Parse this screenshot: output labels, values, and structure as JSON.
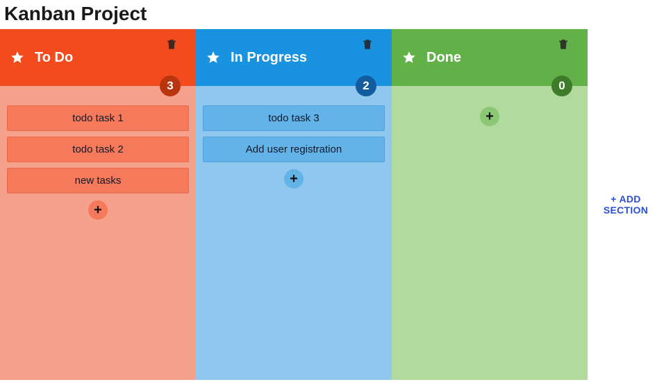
{
  "title": "Kanban Project",
  "add_section_label": "+ ADD SECTION",
  "columns": [
    {
      "key": "todo",
      "title": "To Do",
      "count": "3",
      "cards": [
        "todo task 1",
        "todo task 2",
        "new tasks"
      ]
    },
    {
      "key": "progress",
      "title": "In Progress",
      "count": "2",
      "cards": [
        "todo task 3",
        "Add user registration"
      ]
    },
    {
      "key": "done",
      "title": "Done",
      "count": "0",
      "cards": []
    }
  ],
  "icons": {
    "plus": "+"
  }
}
